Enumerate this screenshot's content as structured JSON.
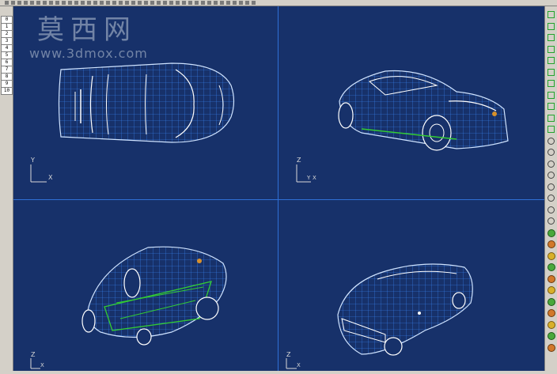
{
  "toolbar": {
    "icon_count": 40
  },
  "layers": [
    "0",
    "1",
    "2",
    "3",
    "4",
    "5",
    "6",
    "7",
    "8",
    "9",
    "10"
  ],
  "watermark": {
    "logo_text": "莫西网",
    "url_text": "www.3dmox.com"
  },
  "viewports": {
    "top": {
      "axis_x": "X",
      "axis_y": "Y"
    },
    "perspective_front": {
      "axis_z": "Z",
      "axis_y": "Y",
      "axis_x": "X"
    },
    "bottom_view": {
      "axis_z": "Z",
      "axis_x": "X"
    },
    "rear_view": {
      "axis_z": "Z",
      "axis_x": "X"
    }
  },
  "colors": {
    "viewport_bg": "#17316a",
    "wireframe": "#2f7cf0",
    "highlight": "#ffffff",
    "ground": "#33cc33",
    "divider": "#2f6fd6"
  },
  "right_toolbar_icons": [
    "snap-icon",
    "snap-icon",
    "snap-icon",
    "snap-icon",
    "snap-icon",
    "snap-icon",
    "arrow-icon",
    "arrow-icon",
    "arrow-icon",
    "arrow-icon",
    "arrow-icon",
    "zoom-icon",
    "zoom-icon",
    "zoom-icon",
    "zoom-icon",
    "rotate-icon",
    "pan-icon",
    "undo-icon",
    "redo-icon",
    "render-icon",
    "render-icon",
    "render-icon",
    "render-icon",
    "render-icon",
    "render-icon",
    "render-icon",
    "render-icon",
    "render-icon",
    "render-icon",
    "render-icon"
  ]
}
